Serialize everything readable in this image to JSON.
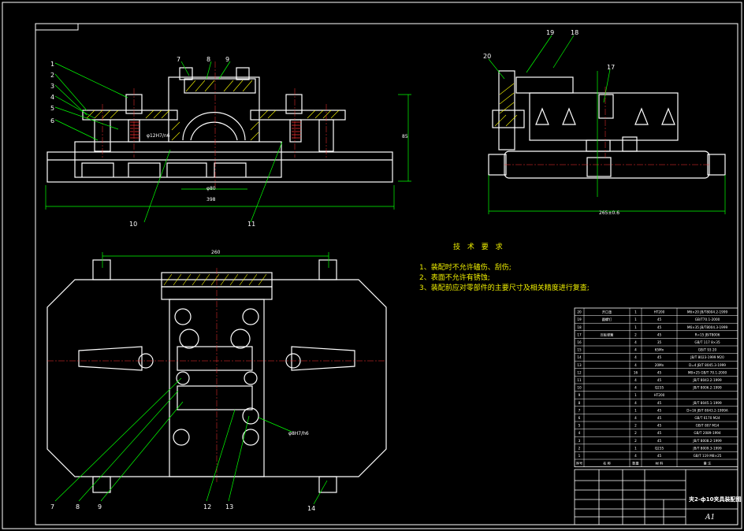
{
  "drawing": {
    "callouts_front": [
      "1",
      "2",
      "3",
      "4",
      "5",
      "6",
      "7",
      "8",
      "9",
      "10",
      "11"
    ],
    "callouts_side": [
      "19",
      "18",
      "20",
      "17"
    ],
    "callouts_top": [
      "7",
      "8",
      "9",
      "12",
      "13",
      "14"
    ],
    "dims": {
      "front_width": "398",
      "front_inner": "φ80",
      "front_height": "85",
      "side_width": "265±0.6",
      "top_width": "260",
      "fit_front": "φ12H7/n6",
      "fit_top": "φ8H7/h6"
    }
  },
  "tech_requirements": {
    "title": "技 术 要 求",
    "items": [
      "1、装配时不允许磕伤、刮伤;",
      "2、表面不允许有锈蚀;",
      "3、装配前应对零部件的主要尺寸及相关精度进行复查;"
    ]
  },
  "bom": {
    "rows": [
      {
        "no": "20",
        "name": "开口垫",
        "qty": "1",
        "mat": "HT200",
        "std": "M6×20 JB/T8004.2-1999"
      },
      {
        "no": "19",
        "name": "圆螺钉",
        "qty": "1",
        "mat": "45",
        "std": "GB/T70.1-2000"
      },
      {
        "no": "18",
        "name": "",
        "qty": "1",
        "mat": "45",
        "std": "M6×35 JB/T8004.3-1999"
      },
      {
        "no": "17",
        "name": "压板弹簧",
        "qty": "2",
        "mat": "45",
        "std": "R=15 JB/T8006"
      },
      {
        "no": "16",
        "name": "",
        "qty": "4",
        "mat": "35",
        "std": "GB/T 117 8×35"
      },
      {
        "no": "15",
        "name": "",
        "qty": "4",
        "mat": "65Mn",
        "std": "GB/T 93 20"
      },
      {
        "no": "14",
        "name": "",
        "qty": "4",
        "mat": "45",
        "std": "JB/T 8023-1999 M20"
      },
      {
        "no": "13",
        "name": "",
        "qty": "4",
        "mat": "20Mn",
        "std": "D=4 JB/T 8045.3-1999"
      },
      {
        "no": "12",
        "name": "",
        "qty": "16",
        "mat": "45",
        "std": "M8×25 GB/T 70.1-2000"
      },
      {
        "no": "11",
        "name": "",
        "qty": "4",
        "mat": "45",
        "std": "JB/T 8043.2-1999"
      },
      {
        "no": "10",
        "name": "",
        "qty": "4",
        "mat": "Q235",
        "std": "JB/T 8006.2-1999"
      },
      {
        "no": "9",
        "name": "",
        "qty": "1",
        "mat": "HT200",
        "std": ""
      },
      {
        "no": "8",
        "name": "",
        "qty": "4",
        "mat": "45",
        "std": "JB/T 8045.1-1999"
      },
      {
        "no": "7",
        "name": "",
        "qty": "1",
        "mat": "45",
        "std": "D=16 JB/T 8043.2-1999A"
      },
      {
        "no": "6",
        "name": "",
        "qty": "4",
        "mat": "45",
        "std": "GB/T 6170 M24"
      },
      {
        "no": "5",
        "name": "",
        "qty": "2",
        "mat": "45",
        "std": "GB/T 807 M14"
      },
      {
        "no": "4",
        "name": "",
        "qty": "2",
        "mat": "45",
        "std": "GB/T 2089-1994"
      },
      {
        "no": "3",
        "name": "",
        "qty": "2",
        "mat": "45",
        "std": "JB/T 8008.2-1999"
      },
      {
        "no": "2",
        "name": "",
        "qty": "1",
        "mat": "Q235",
        "std": "JB/T 8009.3-1999"
      },
      {
        "no": "1",
        "name": "",
        "qty": "4",
        "mat": "45",
        "std": "GB/T 119 M8×25"
      }
    ],
    "header": {
      "no": "序号",
      "name": "名 称",
      "qty": "数量",
      "mat": "材 料",
      "std": "备 注"
    }
  },
  "title_block": {
    "title": "夹2-ф10夹具装配图",
    "sheet_size": "A1"
  },
  "colors": {
    "border": "#ffffff",
    "outline": "#ffffff",
    "dimension": "#00ff00",
    "centerline": "#ff3030",
    "hatch": "#ffff00",
    "text_note": "#f0f000"
  }
}
